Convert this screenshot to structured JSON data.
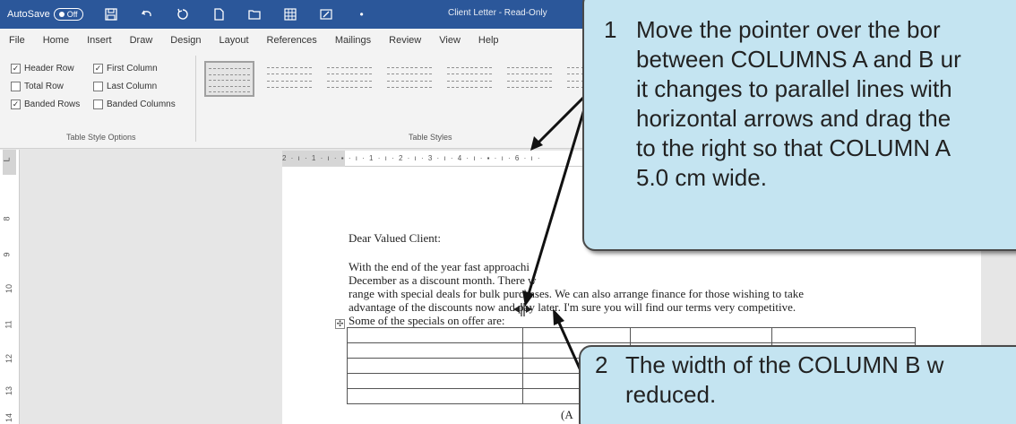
{
  "titlebar": {
    "autosave_label": "AutoSave",
    "autosave_state": "Off",
    "title": "Client Letter  -  Read-Only"
  },
  "ribbon_tabs": [
    "File",
    "Home",
    "Insert",
    "Draw",
    "Design",
    "Layout",
    "References",
    "Mailings",
    "Review",
    "View",
    "Help"
  ],
  "table_style_options": {
    "items": [
      {
        "label": "Header Row",
        "checked": true
      },
      {
        "label": "First Column",
        "checked": true
      },
      {
        "label": "Total Row",
        "checked": false
      },
      {
        "label": "Last Column",
        "checked": false
      },
      {
        "label": "Banded Rows",
        "checked": true
      },
      {
        "label": "Banded Columns",
        "checked": false
      }
    ],
    "group_label": "Table Style Options"
  },
  "table_styles": {
    "group_label": "Table Styles"
  },
  "ruler": {
    "horizontal_ticks": "2 · ı · 1 · ı · ▪ · ı · 1 · ı · 2 · ı · 3 · ı · 4 · ı · ▪ · ı · 6 · ı ·",
    "vertical_marks": [
      "L",
      "8",
      "9",
      "10",
      "11",
      "12",
      "13",
      "14"
    ]
  },
  "document": {
    "greeting": "Dear Valued Client:",
    "paragraph_lines": [
      "With the end of the year fast approachi",
      "December as a discount month.  There w",
      "range with special deals for bulk purchases.  We can also arrange finance for those wishing to take",
      "advantage of the discounts now and pay later.  I'm sure you will find our terms very competitive.",
      "Some of the specials on offer are:"
    ],
    "move_handle": "✣",
    "footer_fragment": "(A"
  },
  "callouts": [
    {
      "number": "1",
      "lines": [
        "Move the pointer over the bor",
        "between COLUMNS A and B ur",
        "it changes to parallel lines with",
        "horizontal arrows and drag the",
        "to the right so that COLUMN A",
        "5.0 cm wide."
      ]
    },
    {
      "number": "2",
      "lines": [
        "The width of the COLUMN B w",
        "reduced."
      ]
    }
  ],
  "colors": {
    "title_bar": "#2b579a",
    "callout_fill": "#c4e4f1"
  }
}
